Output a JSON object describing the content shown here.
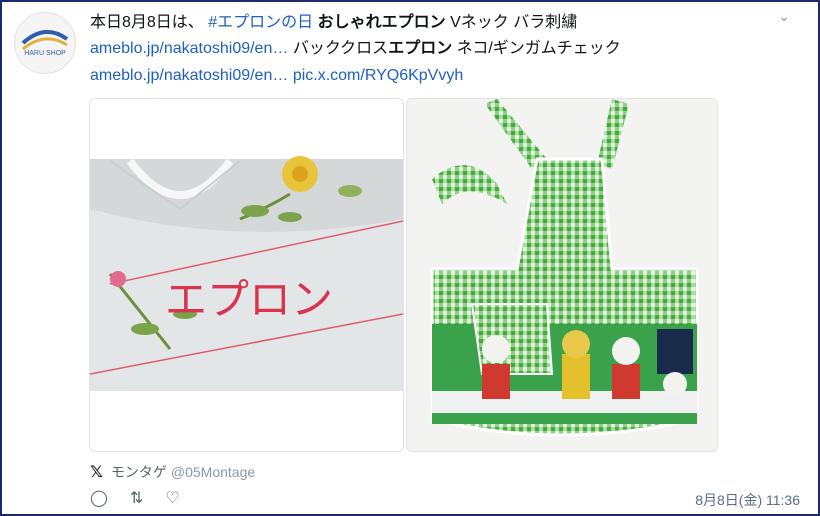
{
  "tweet": {
    "line1": {
      "prefix": "本日8月8日は、",
      "hashtag": "#エプロンの日",
      "bold": "おしゃれエプロン",
      "rest": "Vネック バラ刺繍"
    },
    "line2": {
      "link": "ameblo.jp/nakatoshi09/en…",
      "mid": "バッククロス",
      "bold": "エプロン",
      "rest": "ネコ/ギンガムチェック"
    },
    "line3": {
      "link1": "ameblo.jp/nakatoshi09/en…",
      "link2": "pic.x.com/RYQ6KpVvyh"
    },
    "image1_text": "エプロン"
  },
  "author": {
    "name": "モンタゲ",
    "handle": "@05Montage",
    "avatar_text": "HARU SHOP"
  },
  "timestamp": "8月8日(金) 11:36",
  "icons": {
    "platform": "x-icon",
    "reply": "comment-icon",
    "retweet": "retweet-icon",
    "like": "heart-icon",
    "menu": "chevron-down-icon"
  },
  "colors": {
    "link": "#1d5fc2",
    "border": "#1c2a6b",
    "gingham": "#3fae3a"
  }
}
